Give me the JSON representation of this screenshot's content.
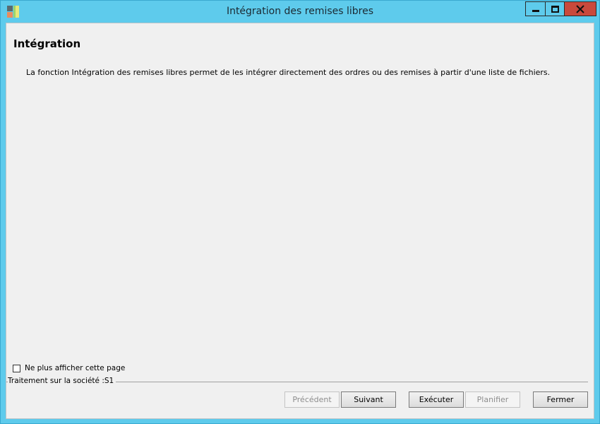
{
  "window": {
    "title": "Intégration des remises libres",
    "icons": {
      "app": "app-icon",
      "minimize": "minimize-icon",
      "maximize": "maximize-icon",
      "close": "close-icon"
    },
    "colors": {
      "frame": "#5ecbec",
      "close_button": "#c9493c",
      "client_background": "#f0f0f0"
    }
  },
  "page": {
    "heading": "Intégration",
    "description": "La fonction Intégration des remises libres permet de les intégrer directement des ordres ou des remises à partir d'une liste de fichiers."
  },
  "footer": {
    "checkbox_label": "Ne plus afficher cette page",
    "checkbox_checked": false,
    "status": "Traitement sur la société :S1"
  },
  "buttons": {
    "previous": "Précédent",
    "next": "Suivant",
    "execute": "Exécuter",
    "schedule": "Planifier",
    "close": "Fermer"
  }
}
